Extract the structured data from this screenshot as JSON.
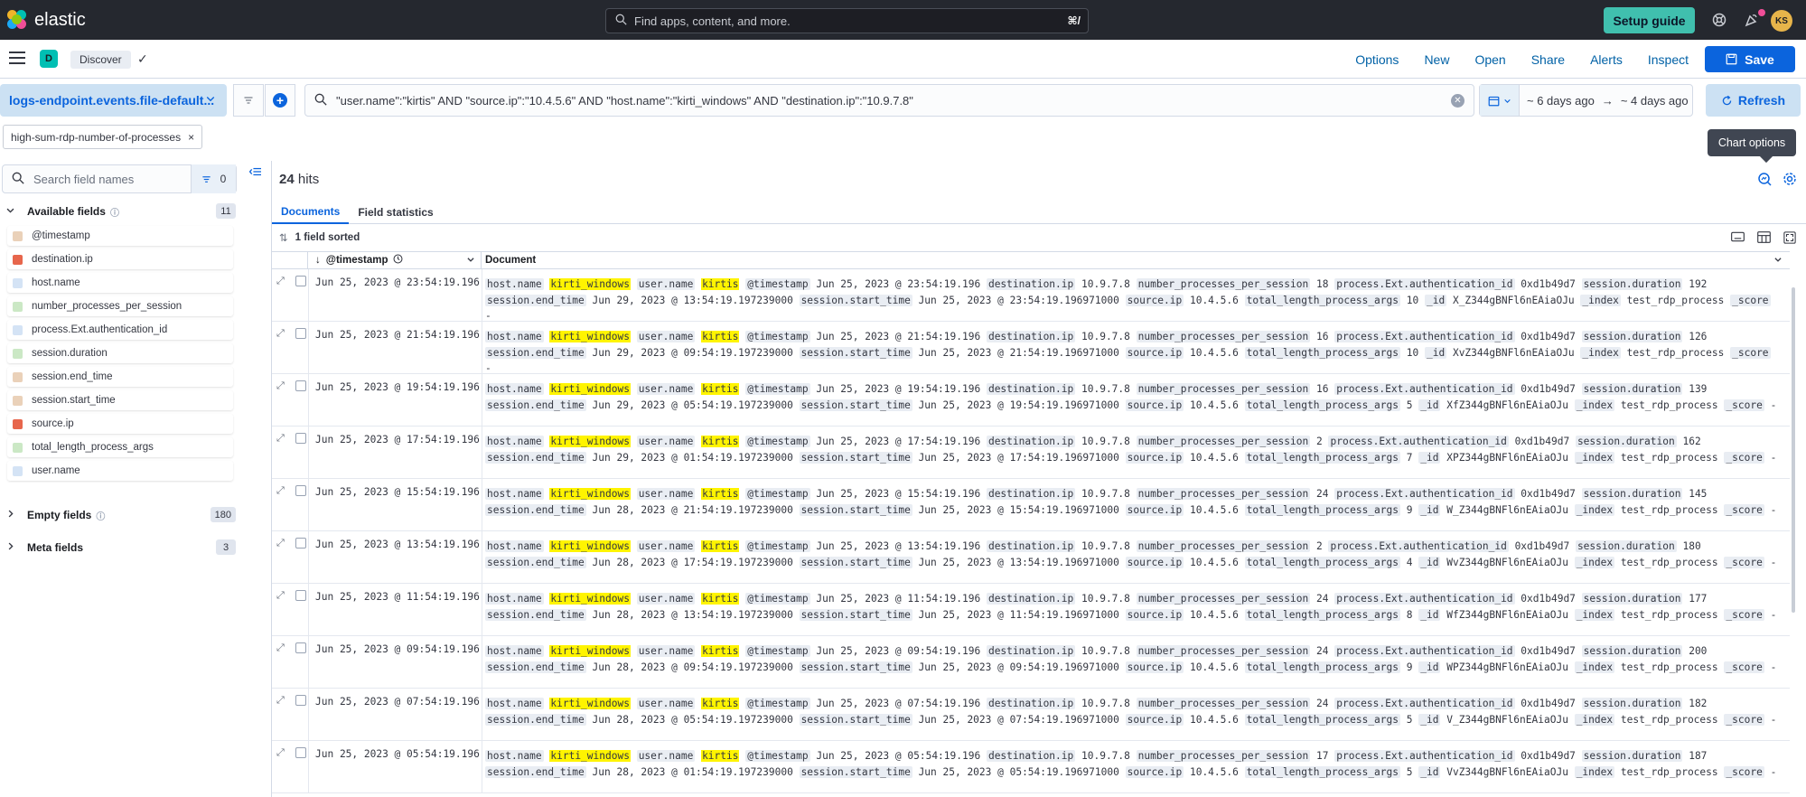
{
  "topbar": {
    "brand": "elastic",
    "search_placeholder": "Find apps, content, and more.",
    "search_shortcut": "⌘/",
    "setup_guide": "Setup guide",
    "avatar_initials": "KS"
  },
  "appbar": {
    "space_initial": "D",
    "breadcrumb": "Discover",
    "links": [
      "Options",
      "New",
      "Open",
      "Share",
      "Alerts",
      "Inspect"
    ],
    "save": "Save"
  },
  "querybar": {
    "data_view": "logs-endpoint.events.file-default...",
    "query": "\"user.name\":\"kirtis\" AND \"source.ip\":\"10.4.5.6\" AND \"host.name\":\"kirti_windows\" AND \"destination.ip\":\"10.9.7.8\"",
    "date_start": "~ 6 days ago",
    "date_arrow": "→",
    "date_end": "~ 4 days ago",
    "refresh": "Refresh"
  },
  "filter_pill": "high-sum-rdp-number-of-processes",
  "tooltip": "Chart options",
  "sidebar": {
    "search_placeholder": "Search field names",
    "filter_count": "0",
    "available_label": "Available fields",
    "available_count": "11",
    "fields": [
      {
        "name": "@timestamp",
        "type": "date"
      },
      {
        "name": "destination.ip",
        "type": "ip"
      },
      {
        "name": "host.name",
        "type": "str"
      },
      {
        "name": "number_processes_per_session",
        "type": "num"
      },
      {
        "name": "process.Ext.authentication_id",
        "type": "str"
      },
      {
        "name": "session.duration",
        "type": "num"
      },
      {
        "name": "session.end_time",
        "type": "date"
      },
      {
        "name": "session.start_time",
        "type": "date"
      },
      {
        "name": "source.ip",
        "type": "ip"
      },
      {
        "name": "total_length_process_args",
        "type": "num"
      },
      {
        "name": "user.name",
        "type": "str"
      }
    ],
    "empty_label": "Empty fields",
    "empty_count": "180",
    "meta_label": "Meta fields",
    "meta_count": "3"
  },
  "main": {
    "hits_count": "24",
    "hits_label": "hits",
    "tabs": [
      "Documents",
      "Field statistics"
    ],
    "sorted_label": "1 field sorted",
    "col_timestamp": "@timestamp",
    "col_document": "Document"
  },
  "rows": [
    {
      "ts": "Jun 25, 2023 @ 23:54:19.196",
      "npps": "18",
      "dur": "192",
      "end": "Jun 29, 2023 @ 13:54:19.197239000",
      "start": "Jun 25, 2023 @ 23:54:19.196971000",
      "tlpa": "10",
      "id": "X_Z344gBNFl6nEAiaOJu"
    },
    {
      "ts": "Jun 25, 2023 @ 21:54:19.196",
      "npps": "16",
      "dur": "126",
      "end": "Jun 29, 2023 @ 09:54:19.197239000",
      "start": "Jun 25, 2023 @ 21:54:19.196971000",
      "tlpa": "10",
      "id": "XvZ344gBNFl6nEAiaOJu"
    },
    {
      "ts": "Jun 25, 2023 @ 19:54:19.196",
      "npps": "16",
      "dur": "139",
      "end": "Jun 29, 2023 @ 05:54:19.197239000",
      "start": "Jun 25, 2023 @ 19:54:19.196971000",
      "tlpa": "5",
      "id": "XfZ344gBNFl6nEAiaOJu"
    },
    {
      "ts": "Jun 25, 2023 @ 17:54:19.196",
      "npps": "2",
      "dur": "162",
      "end": "Jun 29, 2023 @ 01:54:19.197239000",
      "start": "Jun 25, 2023 @ 17:54:19.196971000",
      "tlpa": "7",
      "id": "XPZ344gBNFl6nEAiaOJu"
    },
    {
      "ts": "Jun 25, 2023 @ 15:54:19.196",
      "npps": "24",
      "dur": "145",
      "end": "Jun 28, 2023 @ 21:54:19.197239000",
      "start": "Jun 25, 2023 @ 15:54:19.196971000",
      "tlpa": "9",
      "id": "W_Z344gBNFl6nEAiaOJu"
    },
    {
      "ts": "Jun 25, 2023 @ 13:54:19.196",
      "npps": "2",
      "dur": "180",
      "end": "Jun 28, 2023 @ 17:54:19.197239000",
      "start": "Jun 25, 2023 @ 13:54:19.196971000",
      "tlpa": "4",
      "id": "WvZ344gBNFl6nEAiaOJu"
    },
    {
      "ts": "Jun 25, 2023 @ 11:54:19.196",
      "npps": "24",
      "dur": "177",
      "end": "Jun 28, 2023 @ 13:54:19.197239000",
      "start": "Jun 25, 2023 @ 11:54:19.196971000",
      "tlpa": "8",
      "id": "WfZ344gBNFl6nEAiaOJu"
    },
    {
      "ts": "Jun 25, 2023 @ 09:54:19.196",
      "npps": "24",
      "dur": "200",
      "end": "Jun 28, 2023 @ 09:54:19.197239000",
      "start": "Jun 25, 2023 @ 09:54:19.196971000",
      "tlpa": "9",
      "id": "WPZ344gBNFl6nEAiaOJu"
    },
    {
      "ts": "Jun 25, 2023 @ 07:54:19.196",
      "npps": "24",
      "dur": "182",
      "end": "Jun 28, 2023 @ 05:54:19.197239000",
      "start": "Jun 25, 2023 @ 07:54:19.196971000",
      "tlpa": "5",
      "id": "V_Z344gBNFl6nEAiaOJu"
    },
    {
      "ts": "Jun 25, 2023 @ 05:54:19.196",
      "npps": "17",
      "dur": "187",
      "end": "Jun 28, 2023 @ 01:54:19.197239000",
      "start": "Jun 25, 2023 @ 05:54:19.196971000",
      "tlpa": "5",
      "id": "VvZ344gBNFl6nEAiaOJu"
    }
  ],
  "doc_constants": {
    "host": "kirti_windows",
    "user": "kirtis",
    "dest_ip": "10.9.7.8",
    "src_ip": "10.4.5.6",
    "auth_id": "0xd1b49d7",
    "index": "test_rdp_process",
    "score": "-"
  }
}
